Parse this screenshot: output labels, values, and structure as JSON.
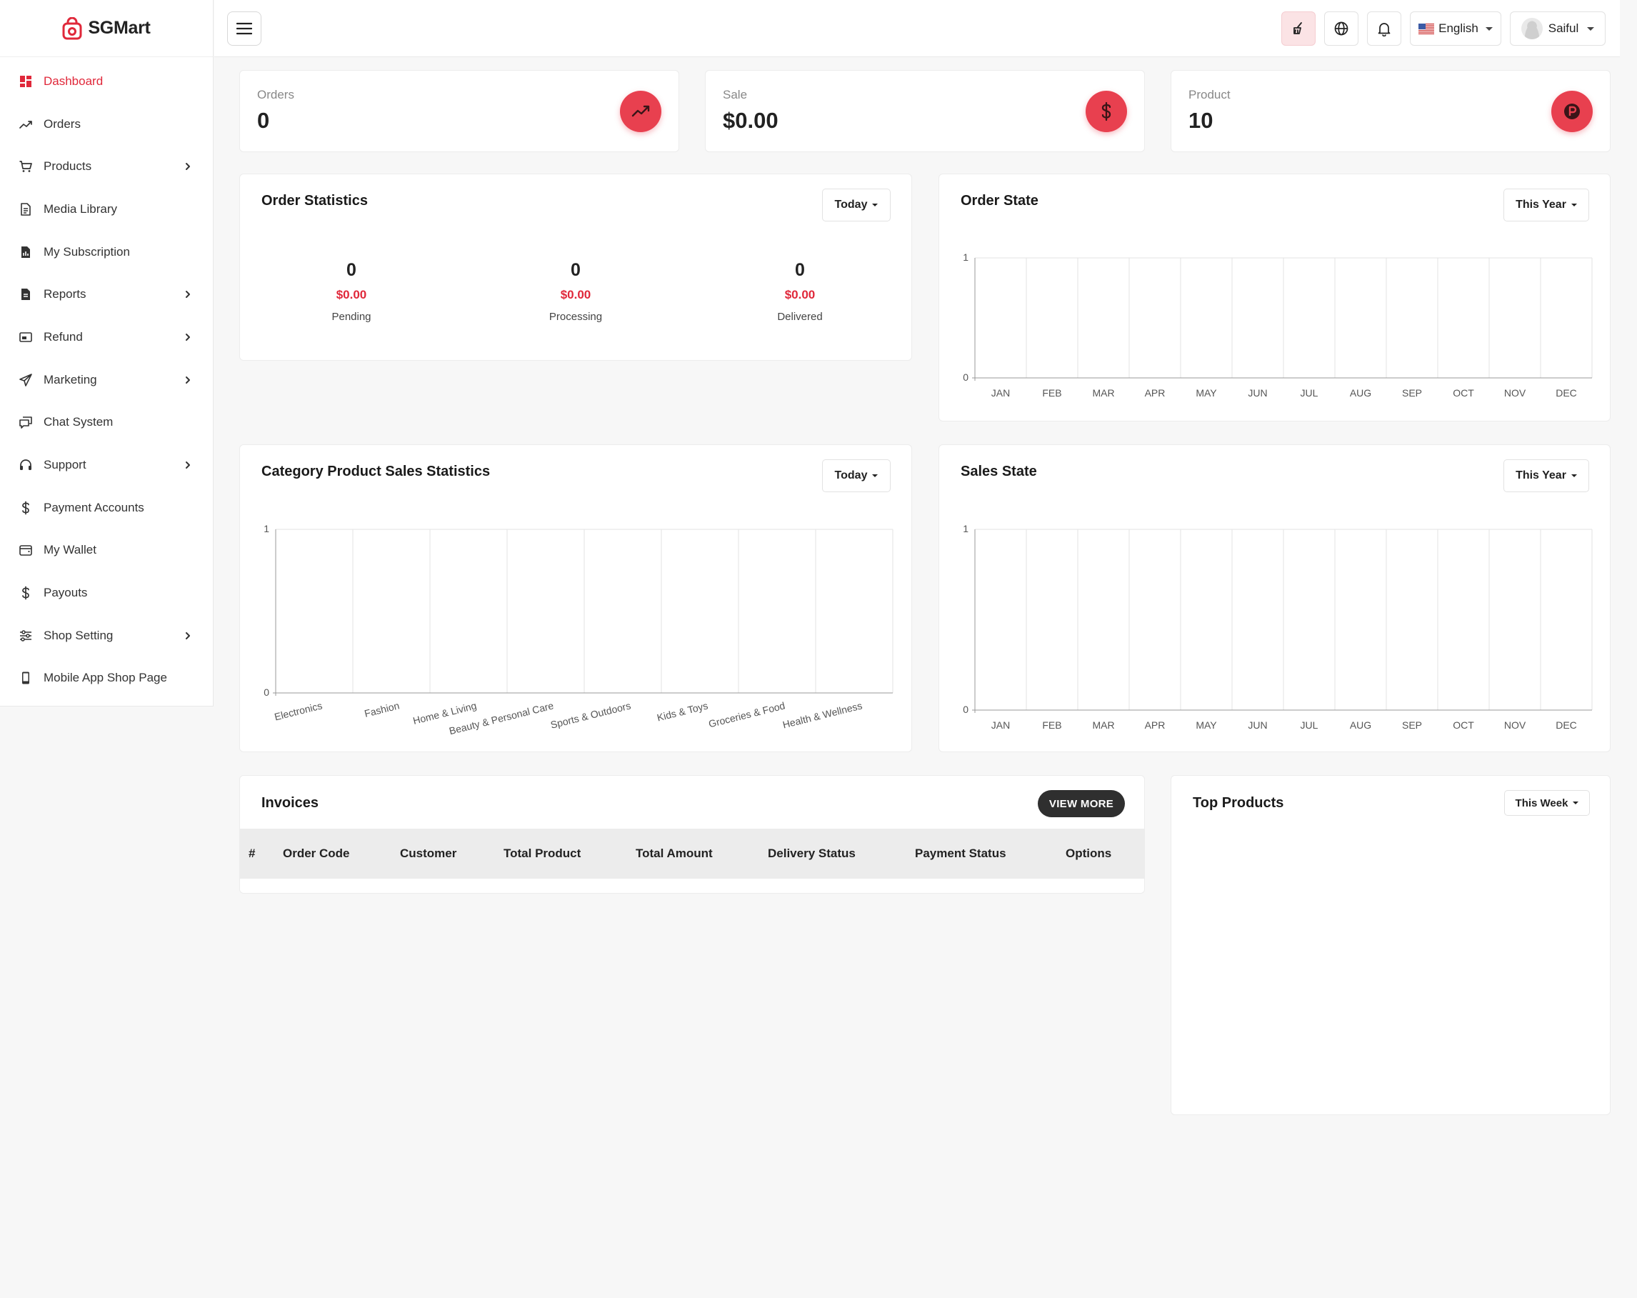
{
  "brand": {
    "name": "SGMart"
  },
  "sidebar": {
    "items": [
      {
        "label": "Dashboard",
        "icon": "dashboard-icon",
        "active": true,
        "has_children": false
      },
      {
        "label": "Orders",
        "icon": "trend-line-icon",
        "active": false,
        "has_children": false
      },
      {
        "label": "Products",
        "icon": "cart-icon",
        "active": false,
        "has_children": true
      },
      {
        "label": "Media Library",
        "icon": "document-icon",
        "active": false,
        "has_children": false
      },
      {
        "label": "My Subscription",
        "icon": "chart-doc-icon",
        "active": false,
        "has_children": false
      },
      {
        "label": "Reports",
        "icon": "report-icon",
        "active": false,
        "has_children": true
      },
      {
        "label": "Refund",
        "icon": "refund-icon",
        "active": false,
        "has_children": true
      },
      {
        "label": "Marketing",
        "icon": "send-icon",
        "active": false,
        "has_children": true
      },
      {
        "label": "Chat System",
        "icon": "chat-icon",
        "active": false,
        "has_children": false
      },
      {
        "label": "Support",
        "icon": "headset-icon",
        "active": false,
        "has_children": true
      },
      {
        "label": "Payment Accounts",
        "icon": "dollar-icon",
        "active": false,
        "has_children": false
      },
      {
        "label": "My Wallet",
        "icon": "wallet-icon",
        "active": false,
        "has_children": false
      },
      {
        "label": "Payouts",
        "icon": "dollar-icon",
        "active": false,
        "has_children": false
      },
      {
        "label": "Shop Setting",
        "icon": "sliders-icon",
        "active": false,
        "has_children": true
      },
      {
        "label": "Mobile App Shop Page",
        "icon": "mobile-icon",
        "active": false,
        "has_children": false
      }
    ]
  },
  "topbar": {
    "language": "English",
    "user": "Saiful"
  },
  "stats": [
    {
      "label": "Orders",
      "value": "0",
      "icon": "trend-up-icon"
    },
    {
      "label": "Sale",
      "value": "$0.00",
      "icon": "dollar-circle-icon"
    },
    {
      "label": "Product",
      "value": "10",
      "icon": "product-p-icon"
    }
  ],
  "order_statistics": {
    "title": "Order Statistics",
    "filter": "Today",
    "columns": [
      {
        "count": "0",
        "amount": "$0.00",
        "label": "Pending"
      },
      {
        "count": "0",
        "amount": "$0.00",
        "label": "Processing"
      },
      {
        "count": "0",
        "amount": "$0.00",
        "label": "Delivered"
      }
    ]
  },
  "order_state": {
    "title": "Order State",
    "filter": "This Year"
  },
  "category_sales": {
    "title": "Category Product Sales Statistics",
    "filter": "Today"
  },
  "sales_state": {
    "title": "Sales State",
    "filter": "This Year"
  },
  "invoices": {
    "title": "Invoices",
    "view_more": "VIEW MORE",
    "columns": [
      "#",
      "Order Code",
      "Customer",
      "Total Product",
      "Total Amount",
      "Delivery Status",
      "Payment Status",
      "Options"
    ]
  },
  "top_products": {
    "title": "Top Products",
    "filter": "This Week"
  },
  "colors": {
    "accent": "#e0283a",
    "icon_bg": "#e8404f"
  },
  "chart_data": [
    {
      "type": "line",
      "title": "Order State",
      "categories": [
        "JAN",
        "FEB",
        "MAR",
        "APR",
        "MAY",
        "JUN",
        "JUL",
        "AUG",
        "SEP",
        "OCT",
        "NOV",
        "DEC"
      ],
      "values": [
        0,
        0,
        0,
        0,
        0,
        0,
        0,
        0,
        0,
        0,
        0,
        0
      ],
      "ylim": [
        0,
        1
      ],
      "yticks": [
        "0",
        "1"
      ],
      "grid": true
    },
    {
      "type": "bar",
      "title": "Category Product Sales Statistics",
      "categories": [
        "Electronics",
        "Fashion",
        "Home & Living",
        "Beauty & Personal Care",
        "Sports & Outdoors",
        "Kids & Toys",
        "Groceries & Food",
        "Health & Wellness"
      ],
      "values": [
        0,
        0,
        0,
        0,
        0,
        0,
        0,
        0
      ],
      "ylim": [
        0,
        1
      ],
      "yticks": [
        "0",
        "1"
      ],
      "grid": true
    },
    {
      "type": "line",
      "title": "Sales State",
      "categories": [
        "JAN",
        "FEB",
        "MAR",
        "APR",
        "MAY",
        "JUN",
        "JUL",
        "AUG",
        "SEP",
        "OCT",
        "NOV",
        "DEC"
      ],
      "values": [
        0,
        0,
        0,
        0,
        0,
        0,
        0,
        0,
        0,
        0,
        0,
        0
      ],
      "ylim": [
        0,
        1
      ],
      "yticks": [
        "0",
        "1"
      ],
      "grid": true
    }
  ]
}
